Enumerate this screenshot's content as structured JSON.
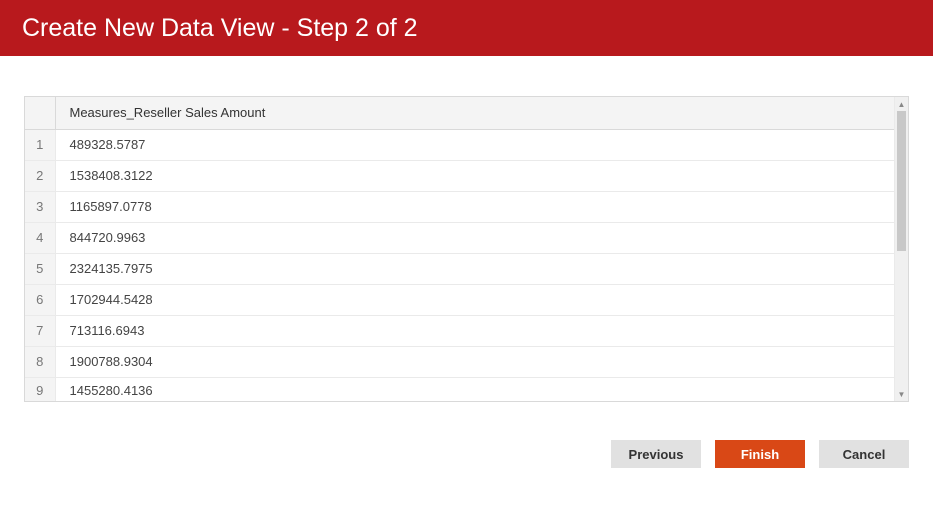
{
  "header": {
    "title": "Create New Data View - Step 2 of 2"
  },
  "grid": {
    "column_header": "Measures_Reseller Sales Amount",
    "rows": [
      {
        "num": "1",
        "value": "489328.5787"
      },
      {
        "num": "2",
        "value": "1538408.3122"
      },
      {
        "num": "3",
        "value": "1165897.0778"
      },
      {
        "num": "4",
        "value": "844720.9963"
      },
      {
        "num": "5",
        "value": "2324135.7975"
      },
      {
        "num": "6",
        "value": "1702944.5428"
      },
      {
        "num": "7",
        "value": "713116.6943"
      },
      {
        "num": "8",
        "value": "1900788.9304"
      },
      {
        "num": "9",
        "value": "1455280.4136"
      }
    ]
  },
  "footer": {
    "previous_label": "Previous",
    "finish_label": "Finish",
    "cancel_label": "Cancel"
  }
}
